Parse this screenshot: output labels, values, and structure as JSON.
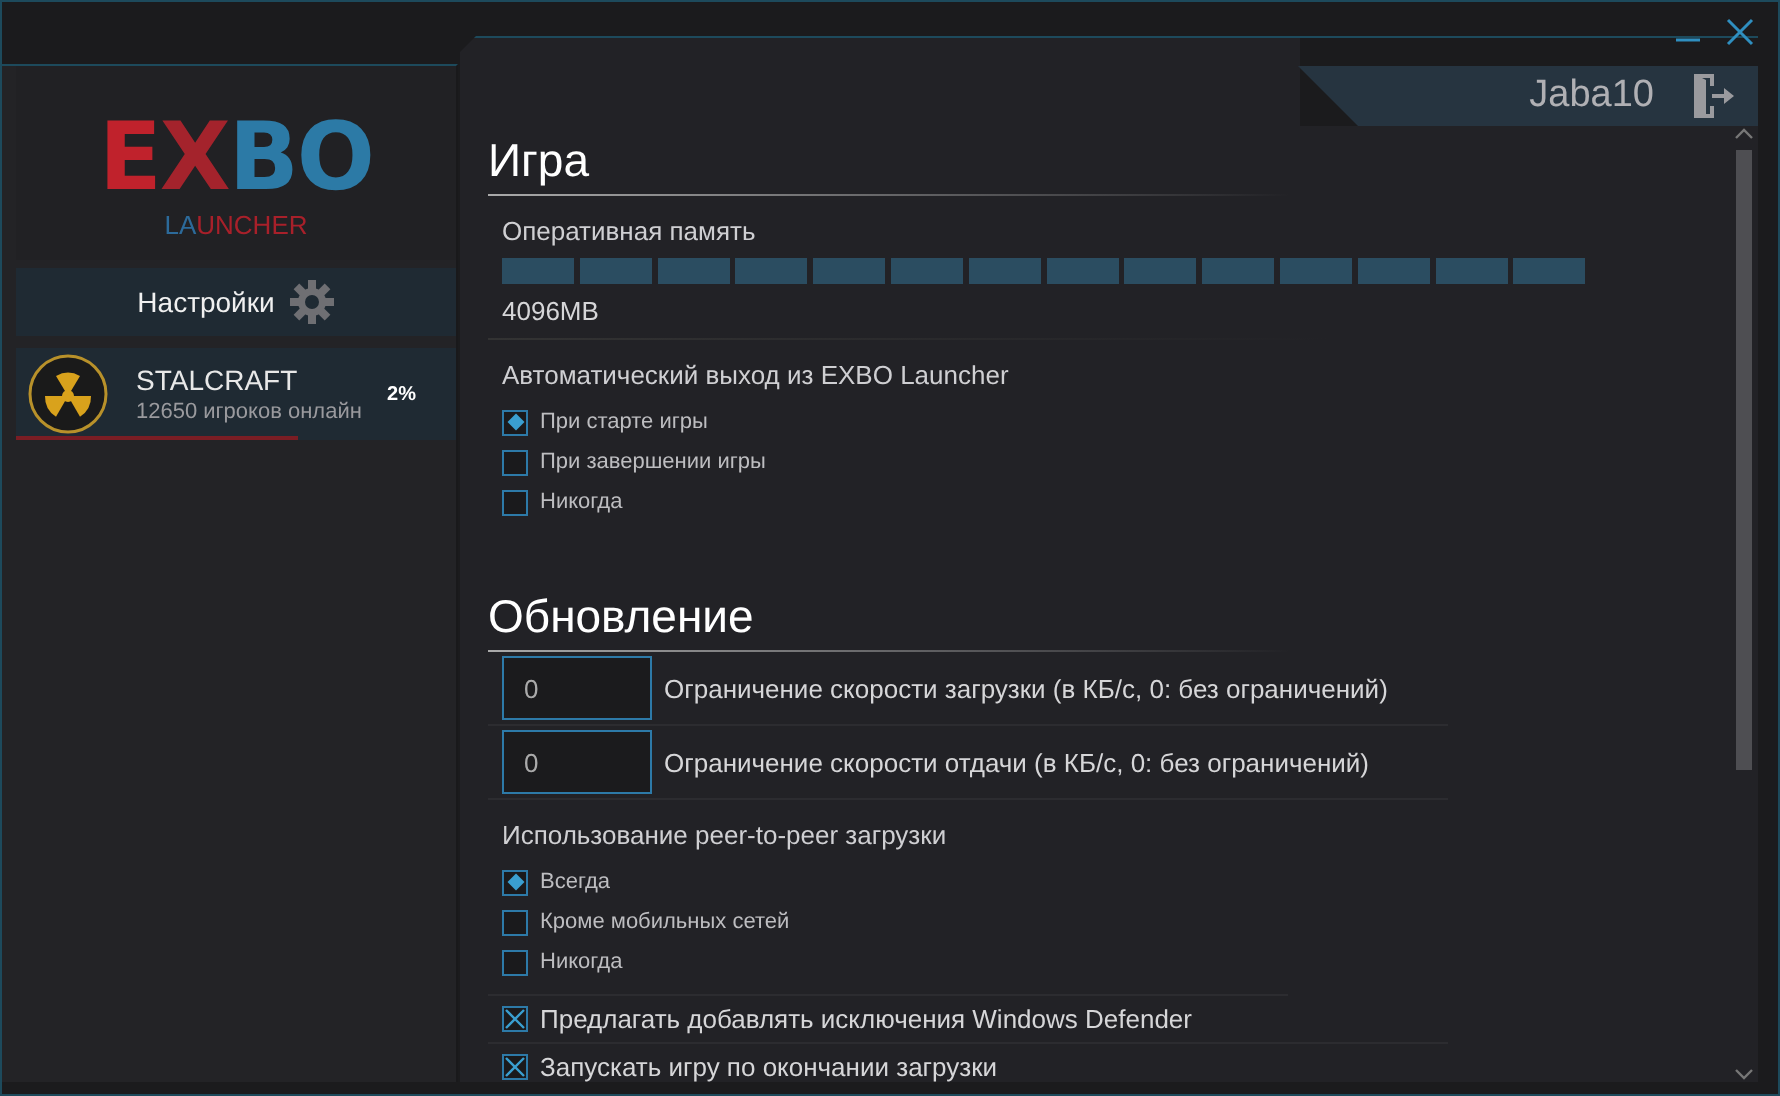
{
  "window": {
    "controls": [
      {
        "kind": "minimize"
      },
      {
        "kind": "close"
      }
    ]
  },
  "sidebar": {
    "logo": {
      "parts": [
        {
          "text": "E",
          "color": "#c0222c"
        },
        {
          "text": "X",
          "color": "#a4232c"
        },
        {
          "text": "BO",
          "color": "#2c7aa6"
        }
      ],
      "sub": [
        {
          "text": "LA",
          "color": "#2c6a9a"
        },
        {
          "text": "UNCHER",
          "color": "#a8202a"
        }
      ]
    },
    "settings_button": {
      "label": "Настройки"
    },
    "games": [
      {
        "name": "STALCRAFT",
        "online": "12650 игроков онлайн",
        "percent": "2%",
        "level": 0.64,
        "selected": true
      }
    ]
  },
  "user": {
    "name": "Jaba10"
  },
  "sections": [
    {
      "title": "Игра",
      "items": [
        {
          "kind": "slider",
          "label": "Оперативная память",
          "level": 1,
          "value": "4096MB"
        },
        {
          "kind": "radios",
          "label": "Автоматический выход из EXBO Launcher",
          "options": [
            {
              "label": "При старте игры",
              "selected": true
            },
            {
              "label": "При завершении игры",
              "selected": false
            },
            {
              "label": "Никогда",
              "selected": false
            }
          ]
        }
      ]
    },
    {
      "title": "Обновление",
      "items": [
        {
          "kind": "number",
          "value": "0",
          "label": "Ограничение скорости загрузки (в КБ/с, 0: без ограничений)"
        },
        {
          "kind": "number",
          "value": "0",
          "label": "Ограничение скорости отдачи (в КБ/с, 0: без ограничений)"
        },
        {
          "kind": "radios",
          "label": "Использование peer-to-peer загрузки",
          "options": [
            {
              "label": "Всегда",
              "selected": true
            },
            {
              "label": "Кроме мобильных сетей",
              "selected": false
            },
            {
              "label": "Никогда",
              "selected": false
            }
          ]
        },
        {
          "kind": "checkbox",
          "label": "Предлагать добавлять исключения Windows Defender",
          "checked": true
        },
        {
          "kind": "checkbox",
          "label": "Запускать игру по окончании загрузки",
          "checked": true
        }
      ]
    }
  ]
}
